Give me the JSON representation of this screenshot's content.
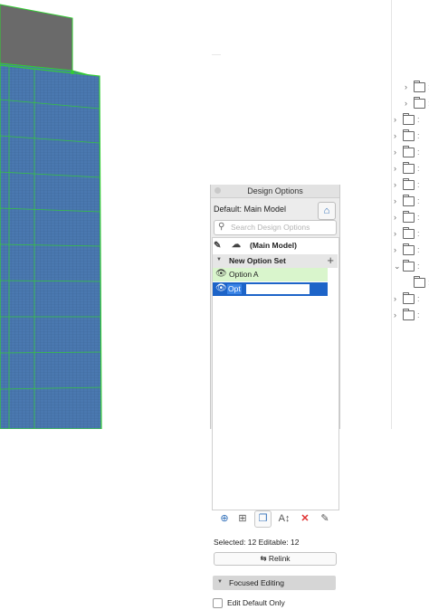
{
  "panel": {
    "title": "Design Options",
    "default_label": "Default: Main Model",
    "search_placeholder": "Search Design Options",
    "main_model_label": "(Main Model)",
    "option_set_label": "New Option Set",
    "option_a_label": "Option A",
    "editing_text": "Opt",
    "selected_info": "Selected: 12 Editable: 12",
    "relink_label": "Relink",
    "focused_editing_label": "Focused Editing",
    "edit_default_only_label": "Edit Default Only",
    "edit_default_only_checked": false
  },
  "toolbar_icons": [
    "add-option-icon",
    "add-set-icon",
    "duplicate-icon",
    "rename-icon",
    "delete-icon",
    "edit-icon"
  ],
  "tree": {
    "rows": [
      {
        "indent": 1,
        "chevron": ">",
        "name": ""
      },
      {
        "indent": 1,
        "chevron": ">",
        "name": ""
      },
      {
        "indent": 0,
        "chevron": ">",
        "name": ""
      },
      {
        "indent": 0,
        "chevron": ">",
        "name": ""
      },
      {
        "indent": 0,
        "chevron": ">",
        "name": ""
      },
      {
        "indent": 0,
        "chevron": ">",
        "name": ""
      },
      {
        "indent": 0,
        "chevron": ">",
        "name": ""
      },
      {
        "indent": 0,
        "chevron": ">",
        "name": ""
      },
      {
        "indent": 0,
        "chevron": ">",
        "name": ""
      },
      {
        "indent": 0,
        "chevron": ">",
        "name": ""
      },
      {
        "indent": 0,
        "chevron": ">",
        "name": ""
      },
      {
        "indent": 0,
        "chevron": "v",
        "name": ""
      },
      {
        "indent": 1,
        "chevron": "",
        "name": ""
      },
      {
        "indent": 0,
        "chevron": ">",
        "name": ""
      },
      {
        "indent": 0,
        "chevron": ">",
        "name": ""
      }
    ]
  },
  "colors": {
    "building_blue": "#4a78b0",
    "selection_green": "#33cc33",
    "roof_gray": "#6a6a6a",
    "highlight_blue": "#1d64c8",
    "option_a_green": "#d9f5cc",
    "delete_red": "#e03030"
  }
}
